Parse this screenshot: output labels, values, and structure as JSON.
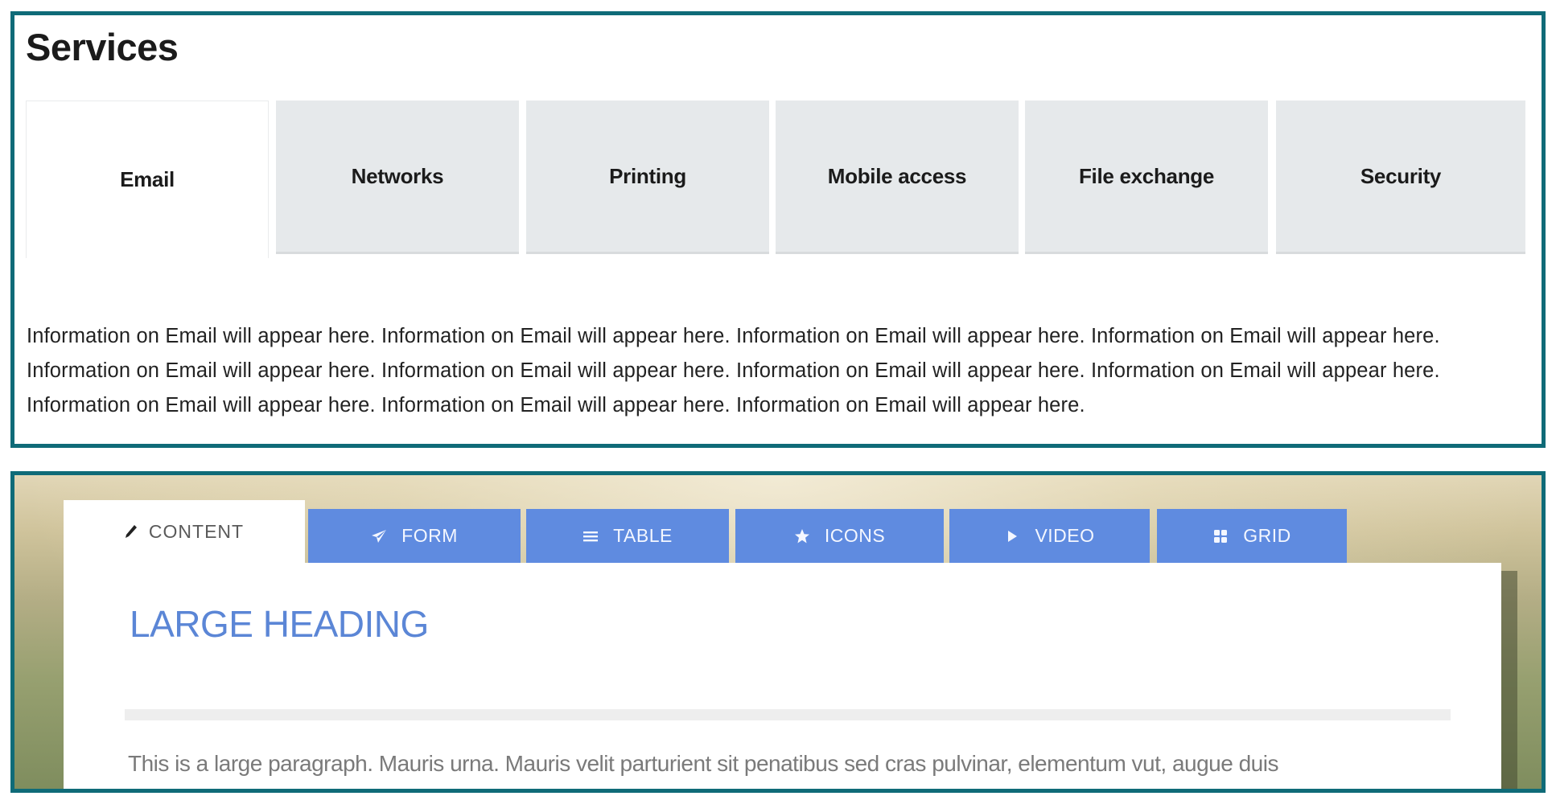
{
  "services": {
    "title": "Services",
    "tabs": [
      {
        "label": "Email",
        "active": true
      },
      {
        "label": "Networks",
        "active": false
      },
      {
        "label": "Printing",
        "active": false
      },
      {
        "label": "Mobile access",
        "active": false
      },
      {
        "label": "File exchange",
        "active": false
      },
      {
        "label": "Security",
        "active": false
      }
    ],
    "panel_text": "Information on Email will appear here. Information on Email will appear here. Information on Email will appear here. Information on Email will appear here. Information on Email will appear here. Information on Email will appear here. Information on Email will appear here. Information on Email will appear here. Information on Email will appear here. Information on Email will appear here. Information on Email will appear here."
  },
  "demo": {
    "tabs": [
      {
        "label": "CONTENT",
        "icon": "pencil-icon",
        "active": true
      },
      {
        "label": "FORM",
        "icon": "paper-plane-icon",
        "active": false
      },
      {
        "label": "TABLE",
        "icon": "list-icon",
        "active": false
      },
      {
        "label": "ICONS",
        "icon": "star-icon",
        "active": false
      },
      {
        "label": "VIDEO",
        "icon": "play-icon",
        "active": false
      },
      {
        "label": "GRID",
        "icon": "grid-icon",
        "active": false
      }
    ],
    "heading": "LARGE HEADING",
    "paragraph": "This is a large paragraph. Mauris urna. Mauris velit parturient sit penatibus sed cras pulvinar, elementum vut, augue duis"
  },
  "colors": {
    "frame_border": "#0f6b78",
    "tab_inactive_bg": "#e6e9eb",
    "demo_tab_bg": "#5f8be0",
    "heading_blue": "#5b86d6"
  }
}
